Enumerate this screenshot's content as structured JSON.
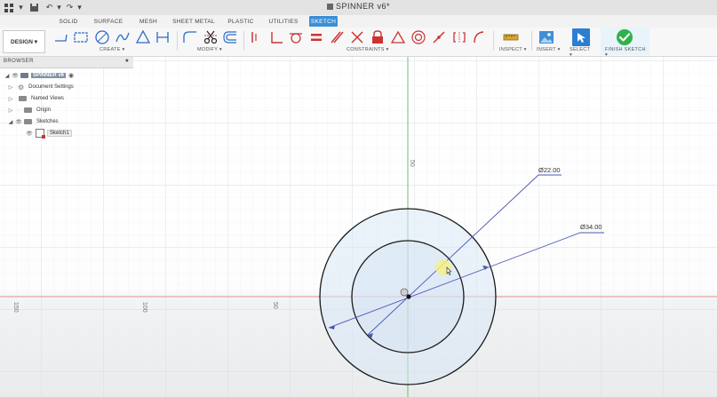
{
  "window": {
    "title": "SPINNER v6*"
  },
  "tabs": [
    {
      "label": "SOLID",
      "active": false
    },
    {
      "label": "SURFACE",
      "active": false
    },
    {
      "label": "MESH",
      "active": false
    },
    {
      "label": "SHEET METAL",
      "active": false
    },
    {
      "label": "PLASTIC",
      "active": false
    },
    {
      "label": "UTILITIES",
      "active": false
    },
    {
      "label": "SKETCH",
      "active": true
    }
  ],
  "toolbar": {
    "workspace_label": "DESIGN ▾",
    "groups": {
      "create": "CREATE ▾",
      "modify": "MODIFY ▾",
      "constraints": "CONSTRAINTS ▾",
      "inspect": "INSPECT ▾",
      "insert": "INSERT ▾",
      "select": "SELECT ▾",
      "finish": "FINISH SKETCH ▾"
    }
  },
  "browser": {
    "title": "BROWSER",
    "nodes": [
      {
        "label": "SPINNER v6"
      },
      {
        "label": "Document Settings"
      },
      {
        "label": "Named Views"
      },
      {
        "label": "Origin"
      },
      {
        "label": "Sketches"
      },
      {
        "label": "Sketch1"
      }
    ]
  },
  "canvas": {
    "axis_labels": {
      "vertical": "50",
      "h1": "150",
      "h2": "100",
      "h3": "50"
    },
    "dimensions": {
      "inner": "Ø22.00",
      "outer": "Ø34.00"
    }
  },
  "colors": {
    "accent": "#3a8fd6",
    "finish_green": "#2fb24a",
    "red_axis": "#e06b6b",
    "green_axis": "#4caf50",
    "dimension_blue": "#4a55b5"
  }
}
